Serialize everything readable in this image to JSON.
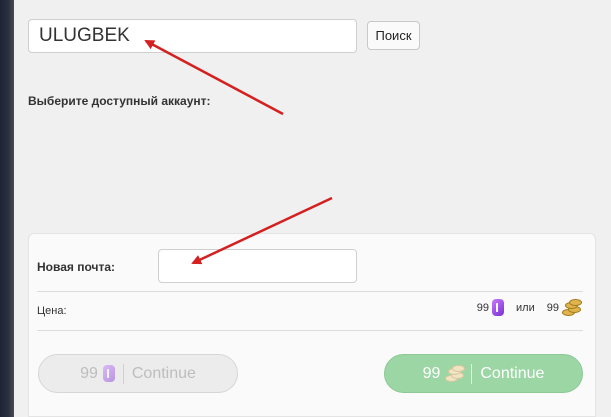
{
  "search": {
    "value": "ULUGBEK",
    "button_label": "Поиск"
  },
  "account_section": {
    "label": "Выберите доступный аккаунт:"
  },
  "form": {
    "email_label": "Новая почта:",
    "email_value": "",
    "price_label": "Цена:",
    "price_gems": "99",
    "or_label": "или",
    "price_coins": "99"
  },
  "buttons": {
    "gems_continue": {
      "amount": "99",
      "label": "Continue"
    },
    "coins_continue": {
      "amount": "99",
      "label": "Continue"
    }
  },
  "icons": {
    "gem": "gem-icon",
    "coins": "gold-coins-icon",
    "annotation": "red-arrow"
  },
  "colors": {
    "background": "#f0f0f0",
    "continue_enabled": "#9cd6a4",
    "continue_disabled": "#ececec",
    "gem": "#9b4ce8",
    "annotation_arrow": "#d42020"
  }
}
